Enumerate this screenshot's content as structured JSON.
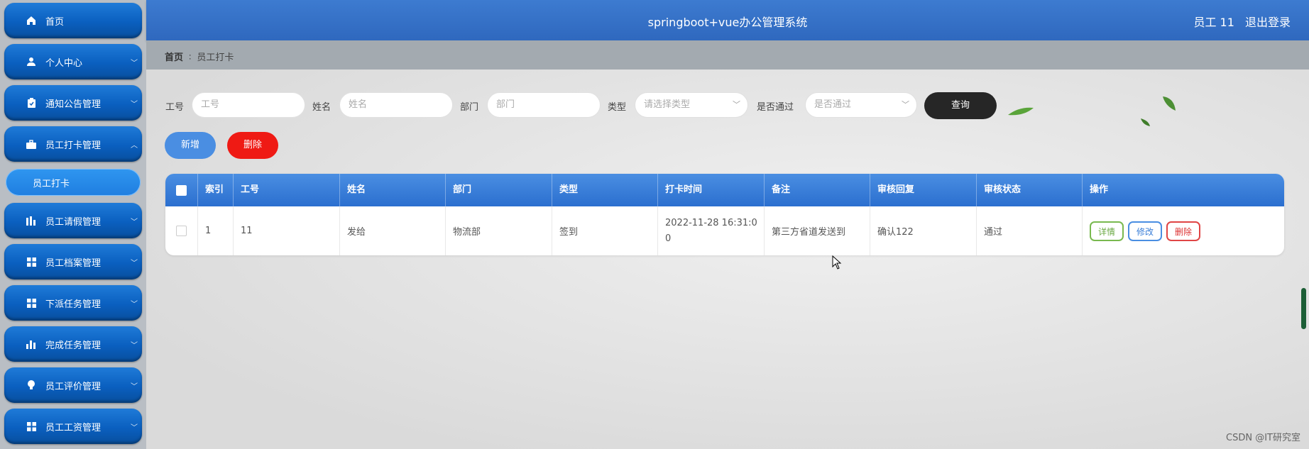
{
  "header": {
    "title": "springboot+vue办公管理系统",
    "user": "员工 11",
    "logout": "退出登录"
  },
  "breadcrumb": {
    "home": "首页",
    "current": "员工打卡"
  },
  "sidebar": {
    "items": [
      {
        "label": "首页",
        "icon": "home-icon"
      },
      {
        "label": "个人中心",
        "icon": "user-icon"
      },
      {
        "label": "通知公告管理",
        "icon": "clipboard-icon"
      },
      {
        "label": "员工打卡管理",
        "icon": "briefcase-icon",
        "expanded": true
      },
      {
        "label": "员工请假管理",
        "icon": "bar-chart-icon"
      },
      {
        "label": "员工档案管理",
        "icon": "grid-icon"
      },
      {
        "label": "下派任务管理",
        "icon": "grid-icon"
      },
      {
        "label": "完成任务管理",
        "icon": "bar-chart-icon"
      },
      {
        "label": "员工评价管理",
        "icon": "bulb-icon"
      },
      {
        "label": "员工工资管理",
        "icon": "grid-icon"
      }
    ],
    "submenu": {
      "label": "员工打卡"
    }
  },
  "search": {
    "fields": [
      {
        "label": "工号",
        "placeholder": "工号"
      },
      {
        "label": "姓名",
        "placeholder": "姓名"
      },
      {
        "label": "部门",
        "placeholder": "部门"
      },
      {
        "label": "类型",
        "placeholder": "请选择类型"
      },
      {
        "label": "是否通过",
        "placeholder": "是否通过"
      }
    ],
    "query_button": "查询"
  },
  "actions": {
    "add": "新增",
    "delete": "删除"
  },
  "table": {
    "columns": [
      "索引",
      "工号",
      "姓名",
      "部门",
      "类型",
      "打卡时间",
      "备注",
      "审核回复",
      "审核状态",
      "操作"
    ],
    "rows": [
      {
        "index": "1",
        "emp_no": "11",
        "name": "发给",
        "dept": "物流部",
        "type": "签到",
        "time_line1": "2022-11-28 16:31:0",
        "time_line2": "0",
        "note": "第三方省道发送到",
        "reply": "确认122",
        "status": "通过"
      }
    ],
    "ops": {
      "detail": "详情",
      "edit": "修改",
      "delete": "删除"
    }
  },
  "watermark": "CSDN @IT研究室",
  "colors": {
    "sidebar_item": "#0a5fbf",
    "header": "#3d7bd0",
    "table_header": "#4a8ee2",
    "query_btn": "#262626",
    "delete_btn": "#ef1a14"
  }
}
